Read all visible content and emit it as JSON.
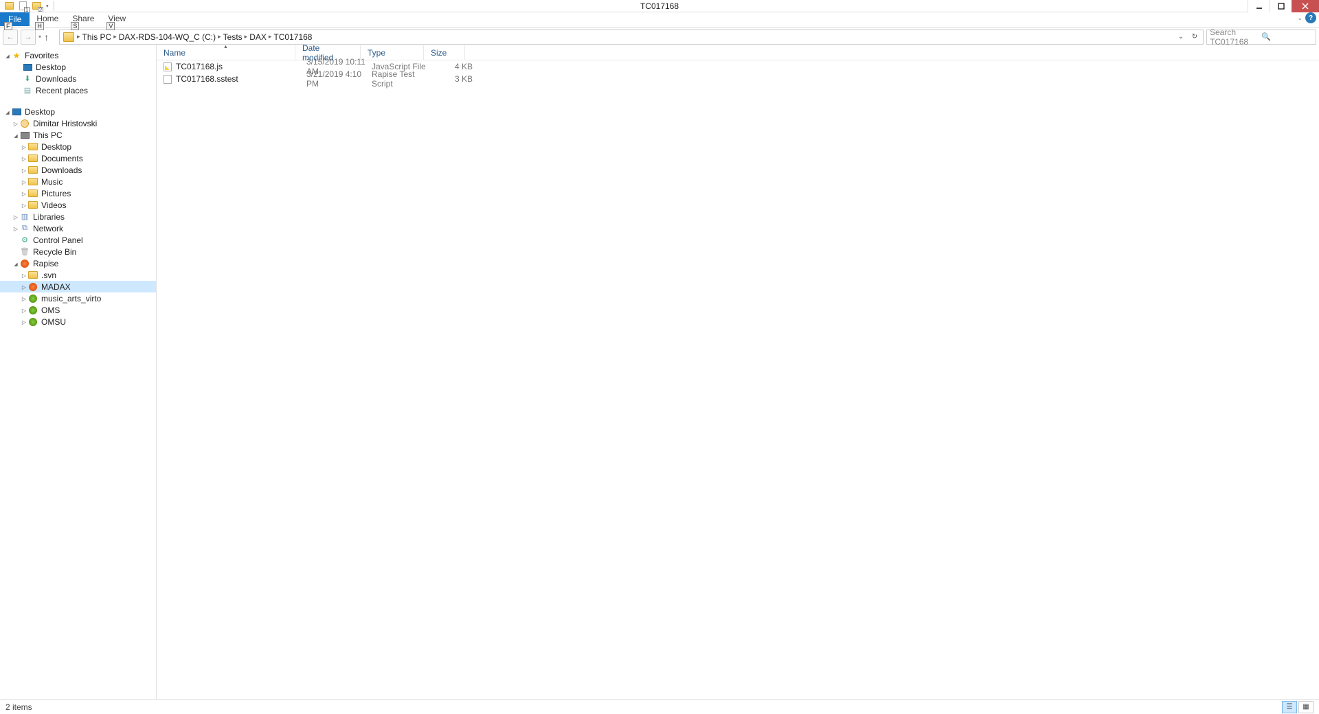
{
  "window": {
    "title": "TC017168"
  },
  "ribbon": {
    "file_label": "File",
    "file_key": "F",
    "tabs": [
      {
        "label": "Home",
        "keytip": "H"
      },
      {
        "label": "Share",
        "keytip": "S"
      },
      {
        "label": "View",
        "keytip": "V"
      }
    ]
  },
  "qat_keytips": {
    "item1": "1",
    "item2": "2"
  },
  "breadcrumbs": [
    {
      "label": "This PC"
    },
    {
      "label": "DAX-RDS-104-WQ_C (C:)"
    },
    {
      "label": "Tests"
    },
    {
      "label": "DAX"
    },
    {
      "label": "TC017168"
    }
  ],
  "search": {
    "placeholder": "Search TC017168"
  },
  "favorites": {
    "header": "Favorites",
    "items": [
      {
        "label": "Desktop",
        "icon": "desktop"
      },
      {
        "label": "Downloads",
        "icon": "downloads"
      },
      {
        "label": "Recent places",
        "icon": "recent"
      }
    ]
  },
  "tree": [
    {
      "label": "Desktop",
      "icon": "desktop",
      "indent": 0,
      "exp": "open"
    },
    {
      "label": "Dimitar Hristovski",
      "icon": "user",
      "indent": 1,
      "exp": "closed"
    },
    {
      "label": "This PC",
      "icon": "pc",
      "indent": 1,
      "exp": "open"
    },
    {
      "label": "Desktop",
      "icon": "folder",
      "indent": 2,
      "exp": "closed"
    },
    {
      "label": "Documents",
      "icon": "folder",
      "indent": 2,
      "exp": "closed"
    },
    {
      "label": "Downloads",
      "icon": "folder",
      "indent": 2,
      "exp": "closed"
    },
    {
      "label": "Music",
      "icon": "folder",
      "indent": 2,
      "exp": "closed"
    },
    {
      "label": "Pictures",
      "icon": "folder",
      "indent": 2,
      "exp": "closed"
    },
    {
      "label": "Videos",
      "icon": "folder",
      "indent": 2,
      "exp": "closed"
    },
    {
      "label": "Libraries",
      "icon": "lib",
      "indent": 1,
      "exp": "closed"
    },
    {
      "label": "Network",
      "icon": "net",
      "indent": 1,
      "exp": "closed"
    },
    {
      "label": "Control Panel",
      "icon": "ctrl",
      "indent": 1,
      "exp": "none"
    },
    {
      "label": "Recycle Bin",
      "icon": "bin",
      "indent": 1,
      "exp": "none"
    },
    {
      "label": "Rapise",
      "icon": "rapise",
      "indent": 1,
      "exp": "open"
    },
    {
      "label": ".svn",
      "icon": "folder",
      "indent": 2,
      "exp": "closed"
    },
    {
      "label": "MADAX",
      "icon": "rapise",
      "indent": 2,
      "exp": "closed",
      "selected": true
    },
    {
      "label": "music_arts_virto",
      "icon": "green",
      "indent": 2,
      "exp": "closed"
    },
    {
      "label": "OMS",
      "icon": "green",
      "indent": 2,
      "exp": "closed"
    },
    {
      "label": "OMSU",
      "icon": "green",
      "indent": 2,
      "exp": "closed"
    }
  ],
  "columns": {
    "name": "Name",
    "date": "Date modified",
    "type": "Type",
    "size": "Size"
  },
  "files": [
    {
      "name": "TC017168.js",
      "date": "3/15/2019 10:11 AM",
      "type": "JavaScript File",
      "size": "4 KB",
      "icon": "js"
    },
    {
      "name": "TC017168.sstest",
      "date": "3/21/2019 4:10 PM",
      "type": "Rapise Test Script",
      "size": "3 KB",
      "icon": "sstest"
    }
  ],
  "status": {
    "text": "2 items"
  }
}
